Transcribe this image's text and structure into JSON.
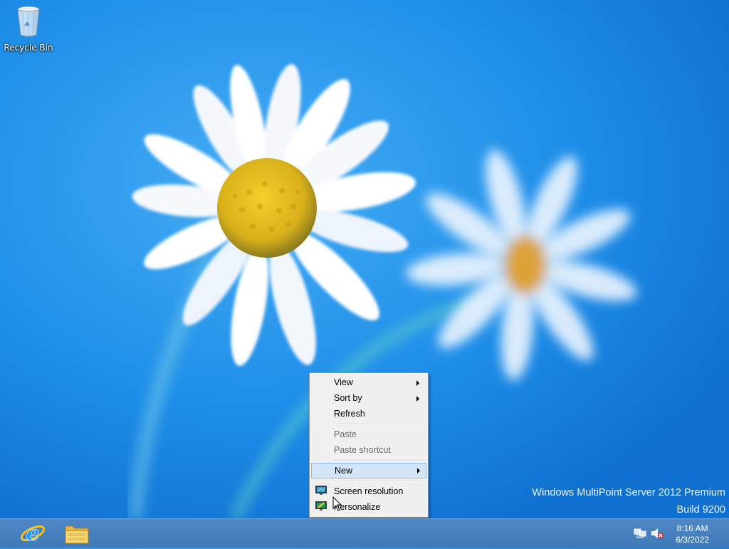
{
  "desktop": {
    "icons": [
      {
        "label": "Recycle Bin",
        "icon": "recycle-bin-icon"
      }
    ],
    "watermark": {
      "line1": "Windows MultiPoint Server 2012 Premium",
      "line2": "Build 9200"
    }
  },
  "context_menu": {
    "items": [
      {
        "label": "View",
        "submenu": true,
        "enabled": true
      },
      {
        "label": "Sort by",
        "submenu": true,
        "enabled": true
      },
      {
        "label": "Refresh",
        "submenu": false,
        "enabled": true
      },
      {
        "label": "Paste",
        "submenu": false,
        "enabled": false
      },
      {
        "label": "Paste shortcut",
        "submenu": false,
        "enabled": false
      },
      {
        "label": "New",
        "submenu": true,
        "enabled": true,
        "highlighted": true
      },
      {
        "label": "Screen resolution",
        "submenu": false,
        "enabled": true,
        "icon": "display-icon"
      },
      {
        "label": "Personalize",
        "submenu": false,
        "enabled": true,
        "icon": "personalize-icon"
      }
    ]
  },
  "taskbar": {
    "pinned": [
      {
        "name": "Internet Explorer",
        "icon": "internet-explorer-icon"
      },
      {
        "name": "File Explorer",
        "icon": "file-explorer-icon"
      }
    ],
    "tray": {
      "icons": [
        "network-icon",
        "volume-muted-icon"
      ],
      "time": "8:16 AM",
      "date": "6/3/2022"
    }
  },
  "colors": {
    "desktop_blue": "#1f8fea",
    "taskbar": "#4581c0",
    "menu_highlight": "#d4e5f7"
  }
}
